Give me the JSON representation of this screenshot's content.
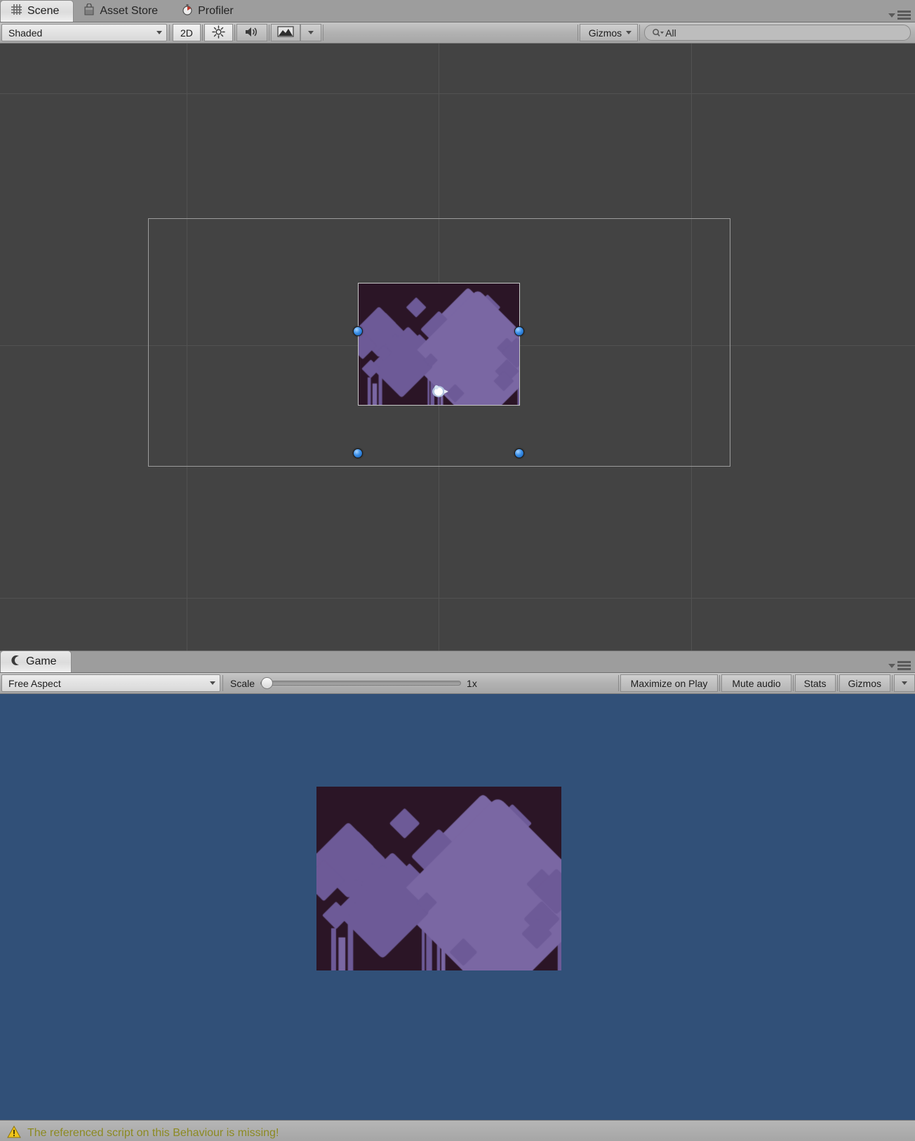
{
  "scene_panel": {
    "tabs": [
      {
        "label": "Scene",
        "icon": "grid-icon",
        "active": true
      },
      {
        "label": "Asset Store",
        "icon": "shopping-bag-icon",
        "active": false
      },
      {
        "label": "Profiler",
        "icon": "stopwatch-icon",
        "active": false
      }
    ],
    "toolbar": {
      "draw_mode": "Shaded",
      "two_d_toggle": "2D",
      "lighting_icon": "sun-icon",
      "audio_icon": "speaker-icon",
      "effects_icon": "image-icon",
      "effects_caret_icon": "chevron-down-icon",
      "gizmos_label": "Gizmos",
      "gizmos_caret_icon": "chevron-down-icon",
      "search_value": "All",
      "search_icon": "search-icon"
    },
    "panel_menu_icon": "panel-options-icon"
  },
  "game_panel": {
    "tabs": [
      {
        "label": "Game",
        "icon": "gamepad-icon",
        "active": true
      }
    ],
    "toolbar": {
      "aspect": "Free Aspect",
      "aspect_caret_icon": "chevron-down-icon",
      "scale_label": "Scale",
      "scale_value": "1x",
      "maximize_on_play": "Maximize on Play",
      "mute_audio": "Mute audio",
      "stats": "Stats",
      "gizmos_label": "Gizmos",
      "gizmos_caret_icon": "chevron-down-icon"
    },
    "panel_menu_icon": "panel-options-icon",
    "background_color": "#315078"
  },
  "status_bar": {
    "warning_icon": "warning-triangle-icon",
    "message": "The referenced script on this Behaviour is missing!",
    "message_color": "#8c8a22"
  },
  "sprite": {
    "name": "city-diamonds-sprite",
    "background_color": "#2b1526",
    "shape_color": "#6d5a97",
    "shape_color_light": "#7a67a3"
  }
}
